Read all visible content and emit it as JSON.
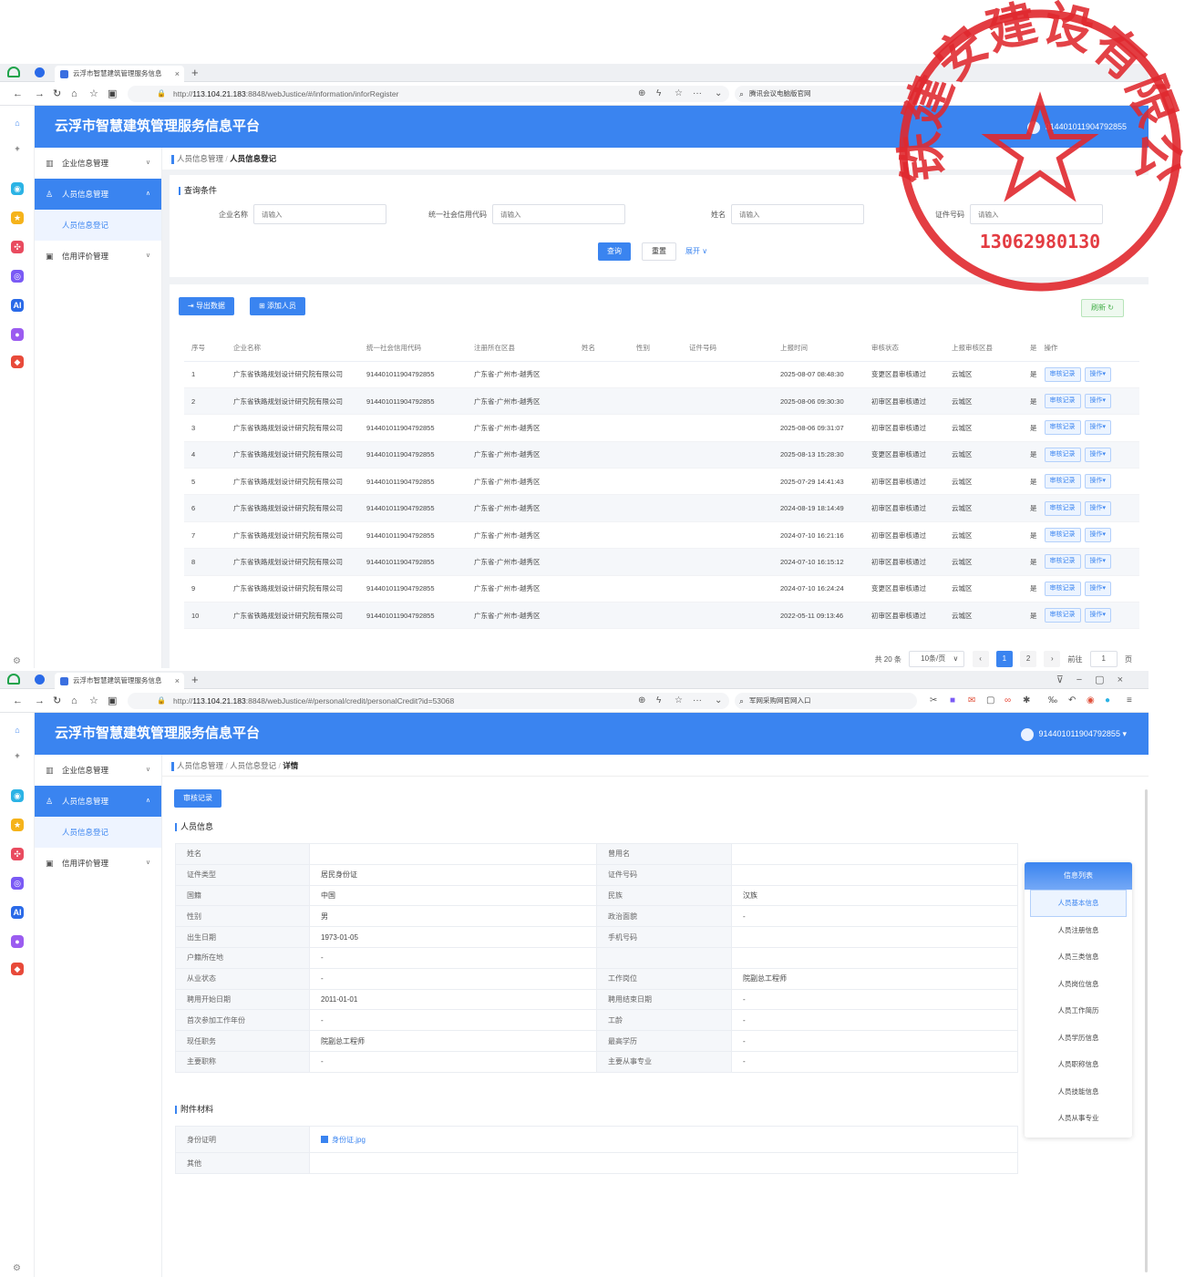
{
  "shots": [
    {
      "browser": {
        "tab_title": "云浮市智慧建筑管理服务信息",
        "url_prefix": "http://",
        "url_host": "113.104.21.183",
        "url_path": ":8848/webJustice/#/information/inforRegister",
        "search_text": "腾讯会议电脑版官网"
      },
      "app": {
        "title": "云浮市智慧建筑管理服务信息平台",
        "user": "914401011904792855"
      },
      "menu": [
        {
          "label": "企业信息管理",
          "icon": "building-icon"
        },
        {
          "label": "人员信息管理",
          "icon": "users-icon"
        },
        {
          "label": "人员信息登记",
          "icon": ""
        },
        {
          "label": "信用评价管理",
          "icon": "credit-icon"
        }
      ],
      "breadcrumb": {
        "parent": "人员信息管理",
        "sep": "/",
        "current": "人员信息登记"
      },
      "query": {
        "section_title": "查询条件",
        "fields": [
          {
            "label": "企业名称",
            "placeholder": "请输入"
          },
          {
            "label": "统一社会信用代码",
            "placeholder": "请输入"
          },
          {
            "label": "姓名",
            "placeholder": "请输入"
          },
          {
            "label": "证件号码",
            "placeholder": "请输入"
          }
        ],
        "search_btn": "查询",
        "reset_btn": "重置",
        "expand_btn": "展开"
      },
      "toolbar": {
        "export": "导出数据",
        "add": "添加人员",
        "refresh": "刷新"
      },
      "table": {
        "columns": [
          "序号",
          "企业名称",
          "统一社会信用代码",
          "注册所在区县",
          "姓名",
          "性别",
          "证件号码",
          "上报时间",
          "审核状态",
          "上报审核区县",
          "是",
          "操作"
        ],
        "rows": [
          [
            "1",
            "广东省铁路规划设计研究院有限公司",
            "914401011904792855",
            "广东省-广州市-越秀区",
            "",
            "",
            "",
            "2025-08-07 08:48:30",
            "变更区县审核通过",
            "云城区",
            "是"
          ],
          [
            "2",
            "广东省铁路规划设计研究院有限公司",
            "914401011904792855",
            "广东省-广州市-越秀区",
            "",
            "",
            "",
            "2025-08-06 09:30:30",
            "初审区县审核通过",
            "云城区",
            "是"
          ],
          [
            "3",
            "广东省铁路规划设计研究院有限公司",
            "914401011904792855",
            "广东省-广州市-越秀区",
            "",
            "",
            "",
            "2025-08-06 09:31:07",
            "初审区县审核通过",
            "云城区",
            "是"
          ],
          [
            "4",
            "广东省铁路规划设计研究院有限公司",
            "914401011904792855",
            "广东省-广州市-越秀区",
            "",
            "",
            "",
            "2025-08-13 15:28:30",
            "变更区县审核通过",
            "云城区",
            "是"
          ],
          [
            "5",
            "广东省铁路规划设计研究院有限公司",
            "914401011904792855",
            "广东省-广州市-越秀区",
            "",
            "",
            "",
            "2025-07-29 14:41:43",
            "初审区县审核通过",
            "云城区",
            "是"
          ],
          [
            "6",
            "广东省铁路规划设计研究院有限公司",
            "914401011904792855",
            "广东省-广州市-越秀区",
            "",
            "",
            "",
            "2024-08-19 18:14:49",
            "初审区县审核通过",
            "云城区",
            "是"
          ],
          [
            "7",
            "广东省铁路规划设计研究院有限公司",
            "914401011904792855",
            "广东省-广州市-越秀区",
            "",
            "",
            "",
            "2024-07-10 16:21:16",
            "初审区县审核通过",
            "云城区",
            "是"
          ],
          [
            "8",
            "广东省铁路规划设计研究院有限公司",
            "914401011904792855",
            "广东省-广州市-越秀区",
            "",
            "",
            "",
            "2024-07-10 16:15:12",
            "初审区县审核通过",
            "云城区",
            "是"
          ],
          [
            "9",
            "广东省铁路规划设计研究院有限公司",
            "914401011904792855",
            "广东省-广州市-越秀区",
            "",
            "",
            "",
            "2024-07-10 16:24:24",
            "变更区县审核通过",
            "云城区",
            "是"
          ],
          [
            "10",
            "广东省铁路规划设计研究院有限公司",
            "914401011904792855",
            "广东省-广州市-越秀区",
            "",
            "",
            "",
            "2022-05-11 09:13:46",
            "初审区县审核通过",
            "云城区",
            "是"
          ]
        ],
        "row_btn_audit": "审核记录",
        "row_btn_op": "操作"
      },
      "pagination": {
        "total": "共 20 条",
        "page_size": "10条/页",
        "page1": "1",
        "page2": "2",
        "goto": "前往",
        "goto_value": "1",
        "page_unit": "页"
      }
    },
    {
      "browser": {
        "tab_title": "云浮市智慧建筑管理服务信息",
        "url_prefix": "http://",
        "url_host": "113.104.21.183",
        "url_path": ":8848/webJustice/#/personal/credit/personalCredit?id=53068",
        "search_text": "军网采购网官网入口"
      },
      "app": {
        "title": "云浮市智慧建筑管理服务信息平台",
        "user": "914401011904792855"
      },
      "breadcrumb": {
        "parent": "人员信息管理",
        "middle": "人员信息登记",
        "sep": "/",
        "current": "详情"
      },
      "audit_btn": "审核记录",
      "person_section": "人员信息",
      "person_rows": [
        [
          "姓名",
          "",
          "曾用名",
          ""
        ],
        [
          "证件类型",
          "居民身份证",
          "证件号码",
          ""
        ],
        [
          "国籍",
          "中国",
          "民族",
          "汉族"
        ],
        [
          "性别",
          "男",
          "政治面貌",
          "-"
        ],
        [
          "出生日期",
          "1973-01-05",
          "手机号码",
          ""
        ],
        [
          "户籍所在地",
          "-",
          "",
          ""
        ],
        [
          "从业状态",
          "-",
          "工作岗位",
          "院副总工程师"
        ],
        [
          "聘用开始日期",
          "2011-01-01",
          "聘用结束日期",
          "-"
        ],
        [
          "首次参加工作年份",
          "-",
          "工龄",
          "-"
        ],
        [
          "现任职务",
          "院副总工程师",
          "最高学历",
          "-"
        ],
        [
          "主要职称",
          "-",
          "主要从事专业",
          "-"
        ]
      ],
      "attach_section": "附件材料",
      "attach_rows": [
        {
          "label": "身份证明",
          "file": "身份证.jpg"
        },
        {
          "label": "其他",
          "file": ""
        }
      ],
      "info_list": {
        "title": "信息列表",
        "items": [
          "人员基本信息",
          "人员注册信息",
          "人员三类信息",
          "人员岗位信息",
          "人员工作简历",
          "人员学历信息",
          "人员职称信息",
          "人员技能信息",
          "人员从事专业"
        ]
      }
    }
  ],
  "stamp": {
    "text": "中铁建安建设有限公司",
    "number": "13062980130",
    "color": "#e0282e"
  },
  "colors": {
    "primary": "#3a84f0",
    "menu_active": "#3a84f0",
    "success": "#46b04b"
  }
}
